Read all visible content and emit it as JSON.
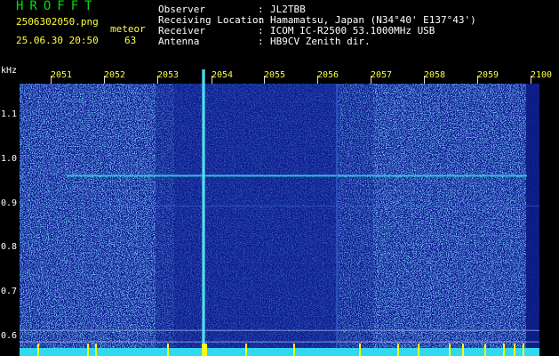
{
  "header": {
    "app_title": "HROFFT",
    "file_name": "2506302050.png",
    "timestamp": "25.06.30 20:50",
    "mode_label": "meteor",
    "count": "63"
  },
  "station": [
    {
      "key": "Observer",
      "value": "JL2TBB"
    },
    {
      "key": "Receiving Location",
      "value": "Hamamatsu, Japan (N34°40' E137°43')"
    },
    {
      "key": "Receiver",
      "value": "ICOM IC-R2500 53.1000MHz USB"
    },
    {
      "key": "Antenna",
      "value": "HB9CV Zenith dir."
    }
  ],
  "x_axis": {
    "labels": [
      "2051",
      "2052",
      "2053",
      "2054",
      "2055",
      "2056",
      "2057",
      "2058",
      "2059",
      "2100"
    ]
  },
  "y_axis": {
    "unit": "kHz",
    "labels": [
      "1.1",
      "1.0",
      "0.9",
      "0.8",
      "0.7",
      "0.6"
    ],
    "range": [
      0.58,
      1.16
    ]
  },
  "signals": {
    "carrier_khz": 0.96,
    "secondary_khz": 0.895,
    "lower_bands_khz": [
      0.625,
      0.6
    ]
  },
  "colors": {
    "title": "#00e000",
    "header_yellow": "#ffff40",
    "header_white": "#ffffff",
    "spectrum_bg": "#0a1a8c",
    "noise_light": "#3a6ad8",
    "noise_cyan": "#30c8e0",
    "level_bar": "#30d8f0",
    "level_marker": "#ffff00"
  }
}
